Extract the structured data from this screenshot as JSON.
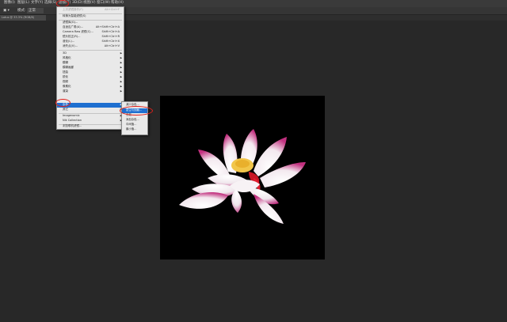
{
  "menubar": {
    "items": [
      "图像(I)",
      "图层(L)",
      "文字(Y)",
      "选择(S)",
      "滤镜(T)",
      "3D(D)",
      "视图(V)",
      "窗口(W)",
      "帮助(H)"
    ],
    "active_index": 4
  },
  "options_bar": {
    "mode_label": "模式:",
    "mode_value": "正常"
  },
  "document_tab": {
    "title": "Lotus @ 33.3% (RGB/8)"
  },
  "filter_menu": {
    "items": [
      {
        "label": "上次滤镜操作(F)",
        "shortcut": "Alt+Ctrl+F",
        "dimmed": true
      },
      {
        "separator": true
      },
      {
        "label": "转换为智能滤镜(S)"
      },
      {
        "separator": true
      },
      {
        "label": "滤镜库(G)..."
      },
      {
        "label": "自适应广角(A)...",
        "shortcut": "Alt+Shift+Ctrl+A"
      },
      {
        "label": "Camera Raw 滤镜(C)...",
        "shortcut": "Shift+Ctrl+A"
      },
      {
        "label": "镜头校正(R)...",
        "shortcut": "Shift+Ctrl+R"
      },
      {
        "label": "液化(L)...",
        "shortcut": "Shift+Ctrl+X"
      },
      {
        "label": "消失点(V)...",
        "shortcut": "Alt+Ctrl+V"
      },
      {
        "separator": true
      },
      {
        "label": "3D",
        "submenu": true
      },
      {
        "label": "风格化",
        "submenu": true
      },
      {
        "label": "模糊",
        "submenu": true
      },
      {
        "label": "模糊画廊",
        "submenu": true
      },
      {
        "label": "扭曲",
        "submenu": true
      },
      {
        "label": "锐化",
        "submenu": true
      },
      {
        "label": "视频",
        "submenu": true
      },
      {
        "label": "像素化",
        "submenu": true
      },
      {
        "label": "渲染",
        "submenu": true
      },
      {
        "label": "杂色",
        "submenu": true,
        "highlighted": true
      },
      {
        "label": "其它",
        "submenu": true
      },
      {
        "separator": true
      },
      {
        "label": "Imagenomic",
        "submenu": true
      },
      {
        "label": "Nik Collection",
        "submenu": true
      },
      {
        "separator": true
      },
      {
        "label": "浏览联机滤镜..."
      }
    ]
  },
  "noise_submenu": {
    "items": [
      {
        "label": "减少杂色..."
      },
      {
        "label": "蒙尘与划痕...",
        "highlighted": true
      },
      {
        "label": "去斑"
      },
      {
        "label": "添加杂色..."
      },
      {
        "label": "中间值..."
      },
      {
        "label": "最小值..."
      }
    ]
  },
  "colors": {
    "highlight": "#1e6fd0",
    "annotation": "#e0201b"
  }
}
